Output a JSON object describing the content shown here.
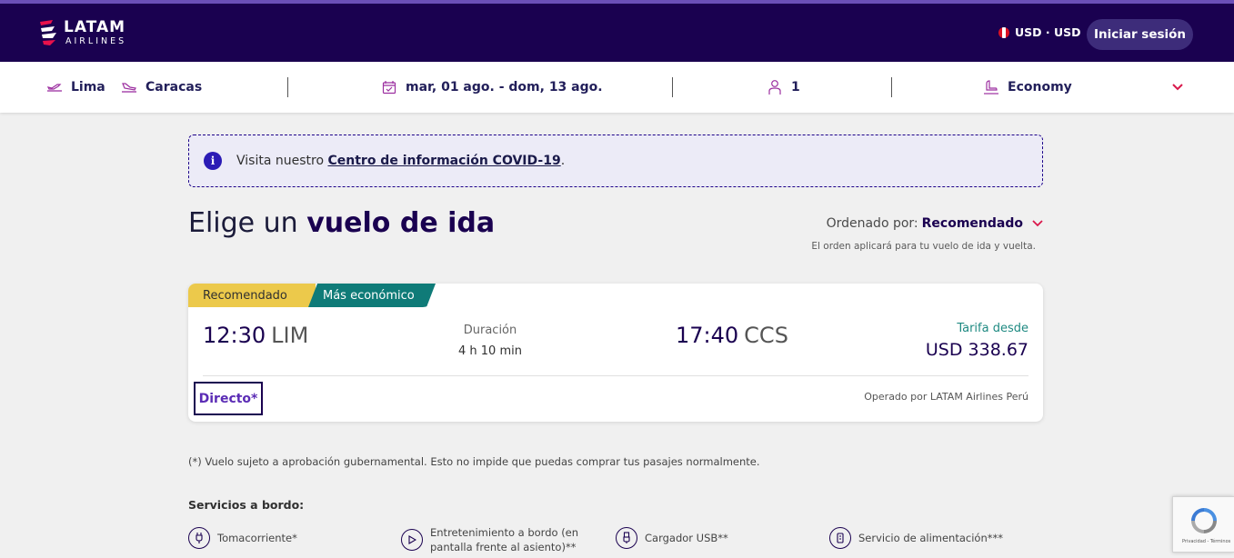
{
  "header": {
    "logo_main": "LATAM",
    "logo_sub": "AIRLINES",
    "currency": "USD · USD",
    "login_label": "Iniciar sesión",
    "colors": {
      "bar": "#1a0150",
      "accent": "#d9184b"
    }
  },
  "search": {
    "origin": "Lima",
    "destination": "Caracas",
    "dates": "mar, 01 ago. - dom, 13 ago.",
    "passengers": "1",
    "cabin": "Economy"
  },
  "covid": {
    "text_before": "Visita nuestro",
    "link": "Centro de información COVID-19",
    "text_after": "."
  },
  "page": {
    "title_light": "Elige un",
    "title_bold": "vuelo de ida",
    "sort_label": "Ordenado por:",
    "sort_value": "Recomendado",
    "sort_note": "El orden aplicará para tu vuelo de ida y vuelta."
  },
  "flight": {
    "tag_recommended": "Recomendado",
    "tag_cheapest": "Más económico",
    "dep_time": "12:30",
    "dep_airport": "LIM",
    "duration_label": "Duración",
    "duration_value": "4 h 10 min",
    "arr_time": "17:40",
    "arr_airport": "CCS",
    "fare_label": "Tarifa desde",
    "fare_value": "USD 338.67",
    "stops": "Directo*",
    "operated": "Operado por LATAM Airlines Perú"
  },
  "footnote": "(*) Vuelo sujeto a aprobación gubernamental. Esto no impide que puedas comprar tus pasajes normalmente.",
  "services": {
    "title": "Servicios a bordo:",
    "items": [
      {
        "label": "Tomacorriente*",
        "icon": "plug-icon"
      },
      {
        "label": "Entretenimiento a bordo (en pantalla frente al asiento)**",
        "icon": "play-icon"
      },
      {
        "label": "Cargador USB**",
        "icon": "usb-icon"
      },
      {
        "label": "Servicio de alimentación***",
        "icon": "meal-icon"
      }
    ]
  },
  "recaptcha": {
    "text": "Privacidad - Términos"
  }
}
